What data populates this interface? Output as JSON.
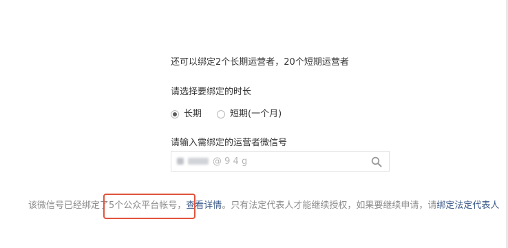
{
  "quota_text": "还可以绑定2个长期运营者，20个短期运营者",
  "duration": {
    "label": "请选择要绑定的时长",
    "options": [
      {
        "label": "长期",
        "selected": true
      },
      {
        "label": "短期(一个月)",
        "selected": false
      }
    ]
  },
  "wechat": {
    "label": "请输入需绑定的运营者微信号",
    "value": "@ 9 4 g",
    "search_icon": "search-icon"
  },
  "notice": {
    "before": "该微信号已经绑定",
    "highlight": "了5个公众平台帐号，",
    "detail_link": "查看详情",
    "after": "。只有法定代表人才能继续授权，如果要继续申请，请",
    "bind_link": "绑定法定代表人",
    "highlight_border_color": "#e0533c",
    "link_color": "#3c5a8a"
  }
}
